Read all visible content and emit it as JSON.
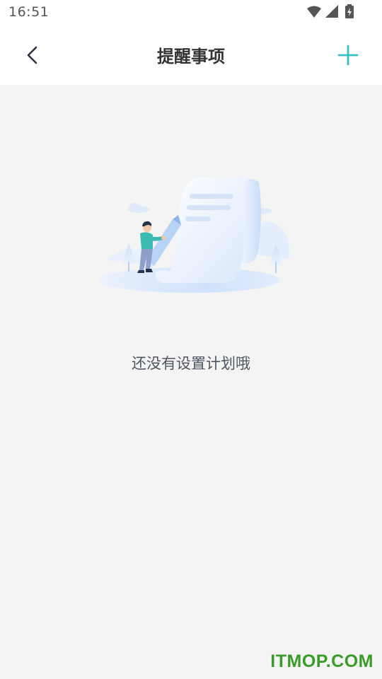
{
  "status_bar": {
    "time": "16:51",
    "icons": [
      "wifi-icon",
      "signal-icon",
      "battery-charging-icon"
    ]
  },
  "nav_bar": {
    "title": "提醒事项",
    "back_icon": "chevron-left-icon",
    "add_icon": "plus-icon",
    "accent_color": "#3bbfc4"
  },
  "empty_state": {
    "illustration": "person-with-pencil-and-scroll-illustration",
    "message": "还没有设置计划哦"
  },
  "watermark": {
    "text": "ITMOP.COM",
    "color": "#3a9b2a"
  }
}
